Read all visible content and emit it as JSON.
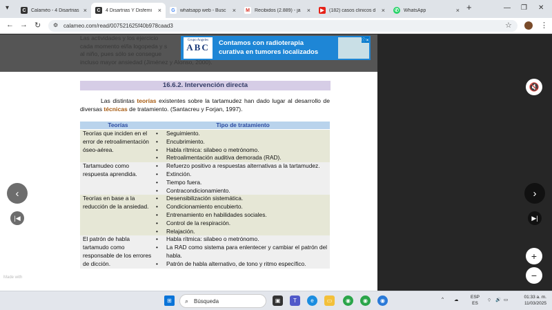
{
  "tabs": [
    {
      "title": "Calaméo - 4 Disartrias",
      "favicon": "calameo-icon",
      "color": "#333"
    },
    {
      "title": "4 Disartrias Y Disfemi",
      "favicon": "calameo-icon",
      "color": "#333"
    },
    {
      "title": "whatsapp web - Busc",
      "favicon": "google-icon",
      "color": "#4285f4"
    },
    {
      "title": "Recibidos (2.889) - ja",
      "favicon": "gmail-icon",
      "color": "#d93025"
    },
    {
      "title": "(182) casos clinicos d",
      "favicon": "youtube-icon",
      "color": "#e62117"
    },
    {
      "title": "WhatsApp",
      "favicon": "whatsapp-icon",
      "color": "#25d366"
    }
  ],
  "url": "calameo.com/read/007521625f40b978caad3",
  "ad": {
    "logo_top": "Grupo Angeles",
    "logo_text": "ABC",
    "line1": "Contamos con radioterapia",
    "line2": "curativa en tumores localizados"
  },
  "doc": {
    "top_text": "Las actividades y los ejercicios ... cada momento el/la logopeda y s... al niño, pues sólo se consegue... incluso mayor ansiedad (Jiménez y Alonso, 2000).",
    "top_line1": "Las actividades y los ejercicio",
    "top_line2": "cada momento el/la logopeda y s",
    "top_line3": "al niño, pues sólo se consegue",
    "top_line4": "incluso mayor ansiedad (Jiménez y Alonso, 2000).",
    "heading": "16.6.2. Intervención directa",
    "para_a": "Las distintas ",
    "para_b": "teorías",
    "para_c": " existentes sobre la tartamudez han dado lugar al desarrollo de diversas ",
    "para_d": "técnicas",
    "para_e": " de tratamiento. (Santacreu y Forjan, 1997).",
    "table": {
      "header": [
        "Teorías",
        "Tipo de tratamiento"
      ],
      "rows": [
        {
          "theory": "Teorías que inciden en el error de retroalimentación óseo-aérea.",
          "items": [
            "Seguimiento.",
            "Encubrimiento.",
            "Habla rítmica: silabeo o metrónomo.",
            "Retroalimentación auditiva demorada (RAD)."
          ]
        },
        {
          "theory": "Tartamudeo como respuesta aprendida.",
          "items": [
            "Refuerzo positivo a respuestas alternativas a la tartamudez.",
            "Extinción.",
            "Tiempo fuera.",
            "Contracondicionamiento."
          ]
        },
        {
          "theory": "Teorías en base a la reducción de la ansiedad.",
          "items": [
            "Desensibilización sistemática.",
            "Condicionamiento encubierto.",
            "Entrenamiento en habilidades sociales.",
            "Control de la respiración.",
            "Relajación."
          ]
        },
        {
          "theory": "El patrón de habla tartamudo como responsable de los errores de dicción.",
          "items": [
            "Habla rítmica: silabeo o metrónomo.",
            "La RAD como sistema para enlentecer y cambiar el patrón del habla.",
            "Patrón de habla alternativo, de tono y ritmo específico."
          ]
        }
      ]
    }
  },
  "branding": {
    "made_with": "Made with",
    "brand": "calaméo"
  },
  "taskbar": {
    "search_placeholder": "Búsqueda",
    "lang1": "ESP",
    "lang2": "ES",
    "time": "01:33 a. m.",
    "date": "11/03/2025"
  }
}
